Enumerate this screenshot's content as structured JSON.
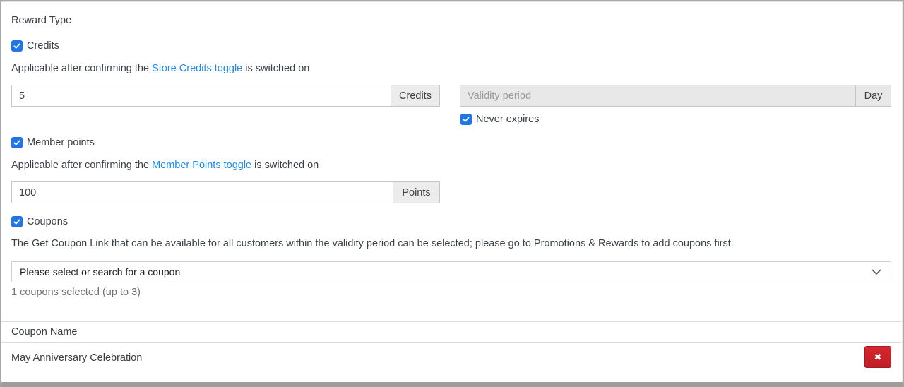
{
  "page": {
    "reward_type_label": "Reward Type"
  },
  "credits": {
    "label": "Credits",
    "checked": true,
    "description_prefix": "Applicable after confirming the ",
    "description_link": "Store Credits toggle",
    "description_suffix": " is switched on",
    "amount_value": "5",
    "amount_unit": "Credits"
  },
  "validity": {
    "placeholder": "Validity period",
    "unit": "Day",
    "never_expires_label": "Never expires",
    "never_expires_checked": true
  },
  "member_points": {
    "label": "Member points",
    "checked": true,
    "description_prefix": "Applicable after confirming the ",
    "description_link": "Member Points toggle",
    "description_suffix": " is switched on",
    "amount_value": "100",
    "amount_unit": "Points"
  },
  "coupons": {
    "label": "Coupons",
    "checked": true,
    "description": "The Get Coupon Link that can be available for all customers within the validity period can be selected; please go to Promotions & Rewards to add coupons first.",
    "select_placeholder": "Please select or search for a coupon",
    "selected_count_text": "1 coupons selected (up to 3)",
    "table": {
      "header": "Coupon Name",
      "rows": [
        {
          "name": "May Anniversary Celebration"
        }
      ]
    },
    "delete_icon": "✖"
  },
  "colors": {
    "accent_blue": "#2176e6",
    "link_blue": "#1f8ceb",
    "danger_red": "#c52028",
    "frame_gray": "#a9a9a9"
  }
}
